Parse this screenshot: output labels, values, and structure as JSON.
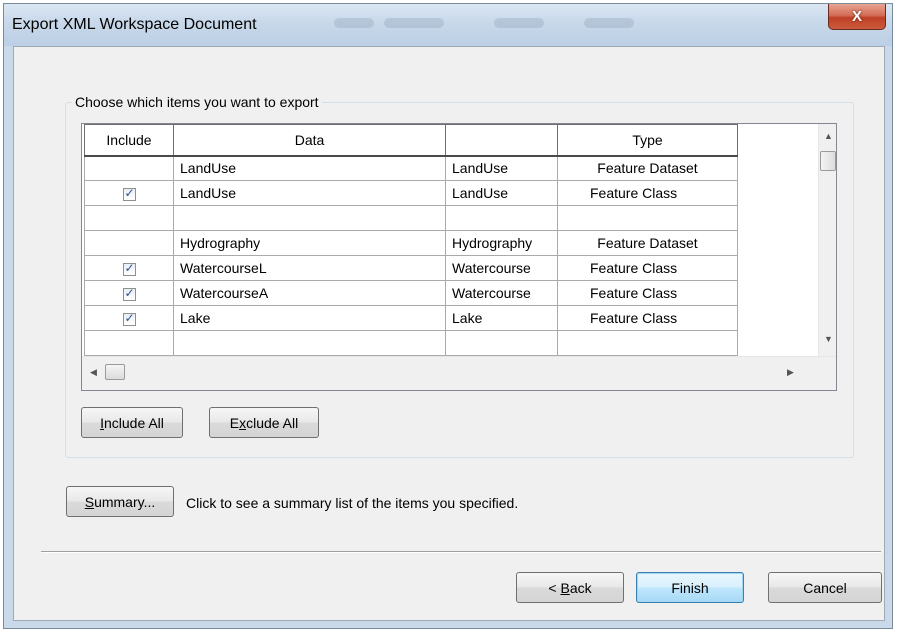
{
  "window": {
    "title": "Export XML Workspace Document",
    "close_label": "X"
  },
  "group": {
    "legend": "Choose which items you want to export"
  },
  "table": {
    "columns": [
      "Include",
      "Data",
      "",
      "Type"
    ],
    "rows": [
      {
        "checkbox": false,
        "checked": false,
        "data": "LandUse",
        "dataset": "LandUse",
        "type": "Feature Dataset",
        "indent_type": false
      },
      {
        "checkbox": true,
        "checked": true,
        "data": "LandUse",
        "dataset": "LandUse",
        "type": "Feature Class",
        "indent_type": true
      },
      {
        "checkbox": false,
        "checked": false,
        "data": "",
        "dataset": "",
        "type": "",
        "indent_type": false
      },
      {
        "checkbox": false,
        "checked": false,
        "data": "Hydrography",
        "dataset": "Hydrography",
        "type": "Feature Dataset",
        "indent_type": false
      },
      {
        "checkbox": true,
        "checked": true,
        "data": "WatercourseL",
        "dataset": "Watercourse",
        "type": "Feature Class",
        "indent_type": true
      },
      {
        "checkbox": true,
        "checked": true,
        "data": "WatercourseA",
        "dataset": "Watercourse",
        "type": "Feature Class",
        "indent_type": true
      },
      {
        "checkbox": true,
        "checked": true,
        "data": "Lake",
        "dataset": "Lake",
        "type": "Feature Class",
        "indent_type": true
      },
      {
        "checkbox": false,
        "checked": false,
        "data": "",
        "dataset": "",
        "type": "",
        "indent_type": false
      }
    ]
  },
  "buttons": {
    "include_all": {
      "mnemonic": "I",
      "rest": "nclude All"
    },
    "exclude_all": {
      "pre": "E",
      "mnemonic": "x",
      "rest": "clude All"
    },
    "summary": {
      "mnemonic": "S",
      "rest": "ummary..."
    },
    "back": {
      "pre": "< ",
      "mnemonic": "B",
      "rest": "ack"
    },
    "finish": "Finish",
    "cancel": "Cancel"
  },
  "summary_text": "Click to see a summary list of the items you specified.",
  "icons": {
    "scroll_up": "scroll-up-icon",
    "scroll_down": "scroll-down-icon",
    "scroll_left": "scroll-left-icon",
    "scroll_right": "scroll-right-icon",
    "close": "close-icon"
  },
  "colors": {
    "titlebar": "#c8d8ea",
    "close_button": "#c8472c",
    "dialog_bg": "#f0f0f0",
    "default_button_border": "#3c7fb1"
  }
}
